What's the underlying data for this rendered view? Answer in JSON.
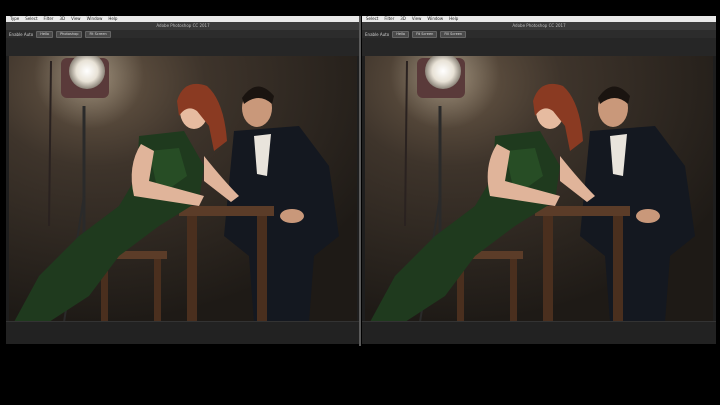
{
  "panels": [
    {
      "menu": [
        "Type",
        "Select",
        "Filter",
        "3D",
        "View",
        "Window",
        "Help"
      ],
      "menu_right": "",
      "window_title": "Adobe Photoshop CC 2017",
      "options": {
        "checkbox": "Enable Auto",
        "buttons": [
          "Hello",
          "Photoshop",
          "Fit Screen"
        ]
      },
      "photo_icon": "portrait-couple-photo"
    },
    {
      "menu": [
        "Select",
        "Filter",
        "3D",
        "View",
        "Window",
        "Help"
      ],
      "menu_right": "",
      "window_title": "Adobe Photoshop CC 2017",
      "options": {
        "checkbox": "Enable Auto",
        "buttons": [
          "Hello",
          "Fit Screen",
          "Fill Screen"
        ]
      },
      "photo_icon": "portrait-couple-photo"
    }
  ],
  "colors": {
    "background": "#000000",
    "menubar": "#e9e9e9",
    "panel": "#1e1e1e",
    "dress": "#1f3a1e"
  }
}
